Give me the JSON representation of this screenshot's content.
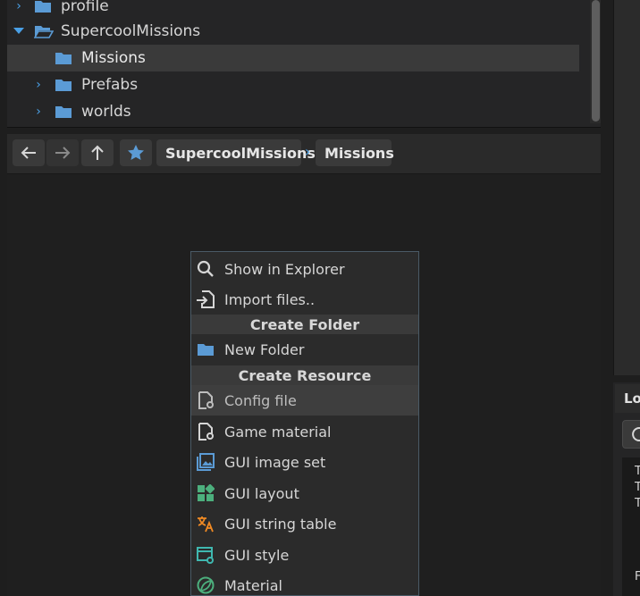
{
  "tree": {
    "items": [
      {
        "label": "profile",
        "expanded": false,
        "selected": false
      },
      {
        "label": "SupercoolMissions",
        "expanded": true,
        "selected": false
      },
      {
        "label": "Missions",
        "expanded": false,
        "selected": true
      },
      {
        "label": "Prefabs",
        "expanded": false,
        "selected": false
      },
      {
        "label": "worlds",
        "expanded": false,
        "selected": false
      }
    ]
  },
  "toolbar": {
    "back_icon": "arrow-left-icon",
    "forward_icon": "arrow-right-icon",
    "up_icon": "arrow-up-icon",
    "favorite_icon": "star-icon",
    "breadcrumb": [
      "SupercoolMissions",
      "Missions"
    ],
    "separator": "›"
  },
  "context_menu": {
    "show_in_explorer": "Show in Explorer",
    "import_files": "Import files..",
    "create_folder_header": "Create Folder",
    "new_folder": "New Folder",
    "create_resource_header": "Create Resource",
    "config_file": "Config file",
    "game_material": "Game material",
    "gui_image_set": "GUI image set",
    "gui_layout": "GUI layout",
    "gui_string_table": "GUI string table",
    "gui_style": "GUI style",
    "material": "Material"
  },
  "log_panel": {
    "tab_label": "Lo",
    "lines": [
      "T",
      "T",
      "T",
      "F"
    ]
  },
  "colors": {
    "accent": "#4aa0e6",
    "folder": "#5b9bd5",
    "teal": "#3fb8b0",
    "green": "#4caf7d",
    "orange": "#f08a24"
  }
}
